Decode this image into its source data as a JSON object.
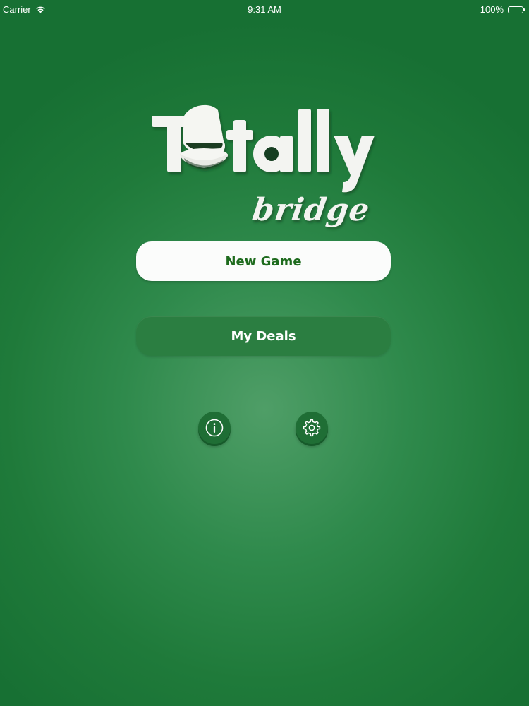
{
  "status_bar": {
    "carrier": "Carrier",
    "time": "9:31 AM",
    "battery_percent": "100%",
    "battery_level": 1.0
  },
  "logo": {
    "brand_text": "Totally bridge"
  },
  "menu": {
    "new_game_label": "New Game",
    "my_deals_label": "My Deals"
  },
  "icons": {
    "info": "info-icon",
    "settings": "gear-icon"
  },
  "colors": {
    "background_green": "#1f7a3a",
    "button_primary_bg": "#fbfcfb",
    "button_primary_text": "#1e6b1d",
    "button_secondary_bg": "#2b7e41",
    "battery_green": "#41d35a"
  }
}
